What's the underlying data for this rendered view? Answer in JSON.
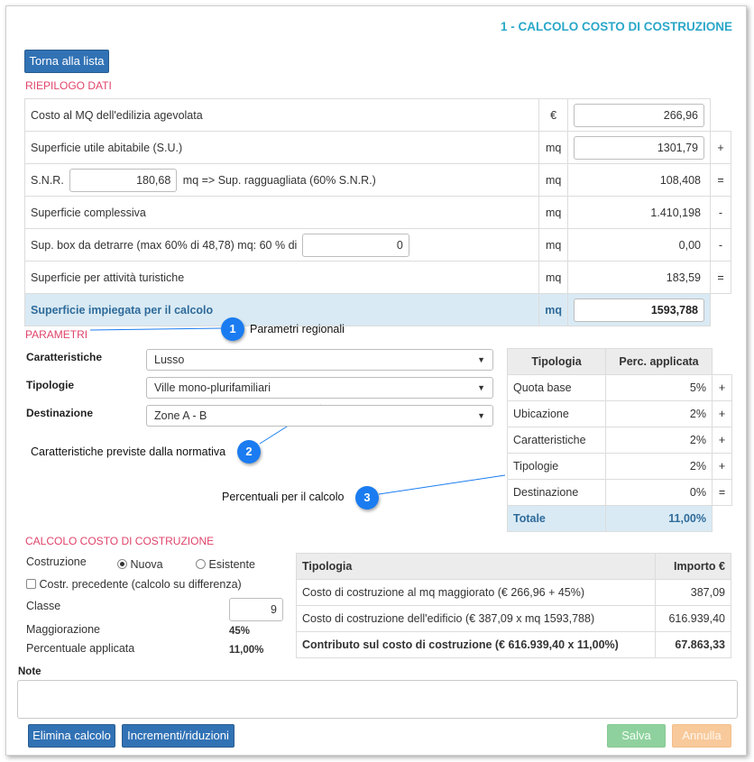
{
  "header": {
    "title": "1 - CALCOLO COSTO DI COSTRUZIONE",
    "back_button": "Torna alla lista"
  },
  "riepilogo": {
    "title": "RIEPILOGO DATI",
    "rows": [
      {
        "label": "Costo al MQ dell'edilizia agevolata",
        "unit": "€",
        "value": "266,96",
        "op": ""
      },
      {
        "label": "Superficie utile abitabile (S.U.)",
        "unit": "mq",
        "value": "1301,79",
        "op": "+"
      },
      {
        "label_pre": "S.N.R.",
        "snr_value": "180,68",
        "label_post": "mq => Sup. ragguagliata (60% S.N.R.)",
        "unit": "mq",
        "value": "108,408",
        "op": "="
      },
      {
        "label": "Superficie complessiva",
        "unit": "mq",
        "value": "1.410,198",
        "op": "-"
      },
      {
        "label": "Sup. box da detrarre (max 60% di 48,78) mq: 60 % di",
        "box_value": "0",
        "unit": "mq",
        "value": "0,00",
        "op": "-"
      },
      {
        "label": "Superficie per attività turistiche",
        "unit": "mq",
        "value": "183,59",
        "op": "="
      },
      {
        "label": "Superficie impiegata per il calcolo",
        "unit": "mq",
        "value": "1593,788"
      }
    ]
  },
  "parametri": {
    "title": "PARAMETRI",
    "caratteristiche": {
      "label": "Caratteristiche",
      "value": "Lusso"
    },
    "tipologie": {
      "label": "Tipologie",
      "value": "Ville mono-plurifamiliari"
    },
    "destinazione": {
      "label": "Destinazione",
      "value": "Zone A - B"
    },
    "table": {
      "headers": [
        "Tipologia",
        "Perc. applicata"
      ],
      "rows": [
        {
          "name": "Quota base",
          "perc": "5%",
          "op": "+"
        },
        {
          "name": "Ubicazione",
          "perc": "2%",
          "op": "+"
        },
        {
          "name": "Caratteristiche",
          "perc": "2%",
          "op": "+"
        },
        {
          "name": "Tipologie",
          "perc": "2%",
          "op": "+"
        },
        {
          "name": "Destinazione",
          "perc": "0%",
          "op": "="
        }
      ],
      "total": {
        "name": "Totale",
        "perc": "11,00%"
      }
    }
  },
  "annotations": {
    "c1": {
      "num": "1",
      "text": "Parametri regionali"
    },
    "c2": {
      "num": "2",
      "text": "Caratteristiche previste dalla normativa"
    },
    "c3": {
      "num": "3",
      "text": "Percentuali per il calcolo"
    }
  },
  "calcolo": {
    "title": "CALCOLO COSTO DI COSTRUZIONE",
    "costruzione_label": "Costruzione",
    "option_nuova": "Nuova",
    "option_esistente": "Esistente",
    "precedente_label": "Costr. precedente (calcolo su differenza)",
    "classe_label": "Classe",
    "classe_value": "9",
    "maggiorazione_label": "Maggiorazione",
    "maggiorazione_value": "45%",
    "percentuale_label": "Percentuale applicata",
    "percentuale_value": "11,00%",
    "table": {
      "headers": [
        "Tipologia",
        "Importo €"
      ],
      "rows": [
        {
          "name": "Costo di costruzione al mq maggiorato (€ 266,96 + 45%)",
          "amount": "387,09"
        },
        {
          "name": "Costo di costruzione dell'edificio (€ 387,09 x mq 1593,788)",
          "amount": "616.939,40"
        },
        {
          "name": "Contributo sul costo di costruzione (€ 616.939,40 x 11,00%)",
          "amount": "67.863,33"
        }
      ]
    }
  },
  "note": {
    "label": "Note",
    "value": ""
  },
  "footer": {
    "elimina": "Elimina calcolo",
    "incrementi": "Incrementi/riduzioni",
    "salva": "Salva",
    "annulla": "Annulla"
  },
  "colors": {
    "accent": "#2aa7c9",
    "section": "#e0436a",
    "primary": "#3172b5",
    "success": "#8fd19e",
    "warning": "#f8c99a",
    "callout": "#1a7cf0"
  }
}
